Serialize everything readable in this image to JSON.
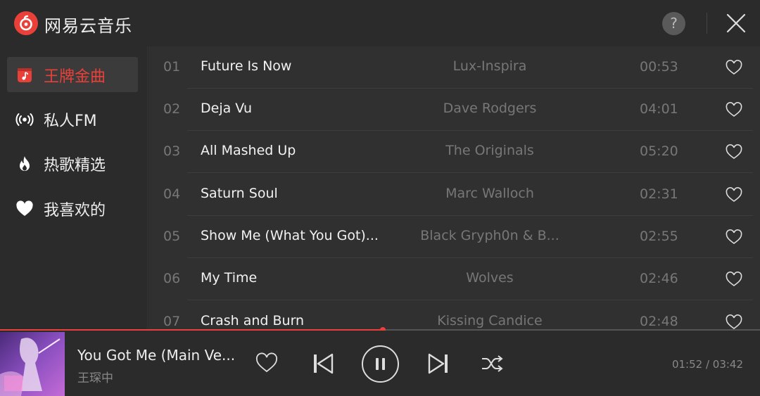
{
  "app": {
    "title": "网易云音乐",
    "help_label": "?"
  },
  "sidebar": {
    "items": [
      {
        "label": "王牌金曲",
        "icon": "music-box-icon",
        "active": true
      },
      {
        "label": "私人FM",
        "icon": "radio-broadcast-icon",
        "active": false
      },
      {
        "label": "热歌精选",
        "icon": "flame-icon",
        "active": false
      },
      {
        "label": "我喜欢的",
        "icon": "heart-icon",
        "active": false
      }
    ]
  },
  "songs": [
    {
      "num": "01",
      "title": "Future Is Now",
      "artist": "Lux-Inspira",
      "duration": "00:53"
    },
    {
      "num": "02",
      "title": "Deja Vu",
      "artist": "Dave Rodgers",
      "duration": "04:01"
    },
    {
      "num": "03",
      "title": "All Mashed Up",
      "artist": "The Originals",
      "duration": "05:20"
    },
    {
      "num": "04",
      "title": "Saturn Soul",
      "artist": "Marc Walloch",
      "duration": "02:31"
    },
    {
      "num": "05",
      "title": "Show Me (What You Got)...",
      "artist": "Black Gryph0n & B...",
      "duration": "02:55"
    },
    {
      "num": "06",
      "title": "My Time",
      "artist": "Wolves",
      "duration": "02:46"
    },
    {
      "num": "07",
      "title": "Crash and Burn",
      "artist": "Kissing Candice",
      "duration": "02:48"
    }
  ],
  "player": {
    "title": "You Got Me (Main Ve...",
    "artist": "王琛中",
    "time": "01:52 / 03:42",
    "progress_fraction": 0.504,
    "state": "playing"
  },
  "colors": {
    "accent": "#e9403a",
    "background": "#2b2b2b",
    "list_background": "#303030",
    "muted_text": "#777777"
  }
}
